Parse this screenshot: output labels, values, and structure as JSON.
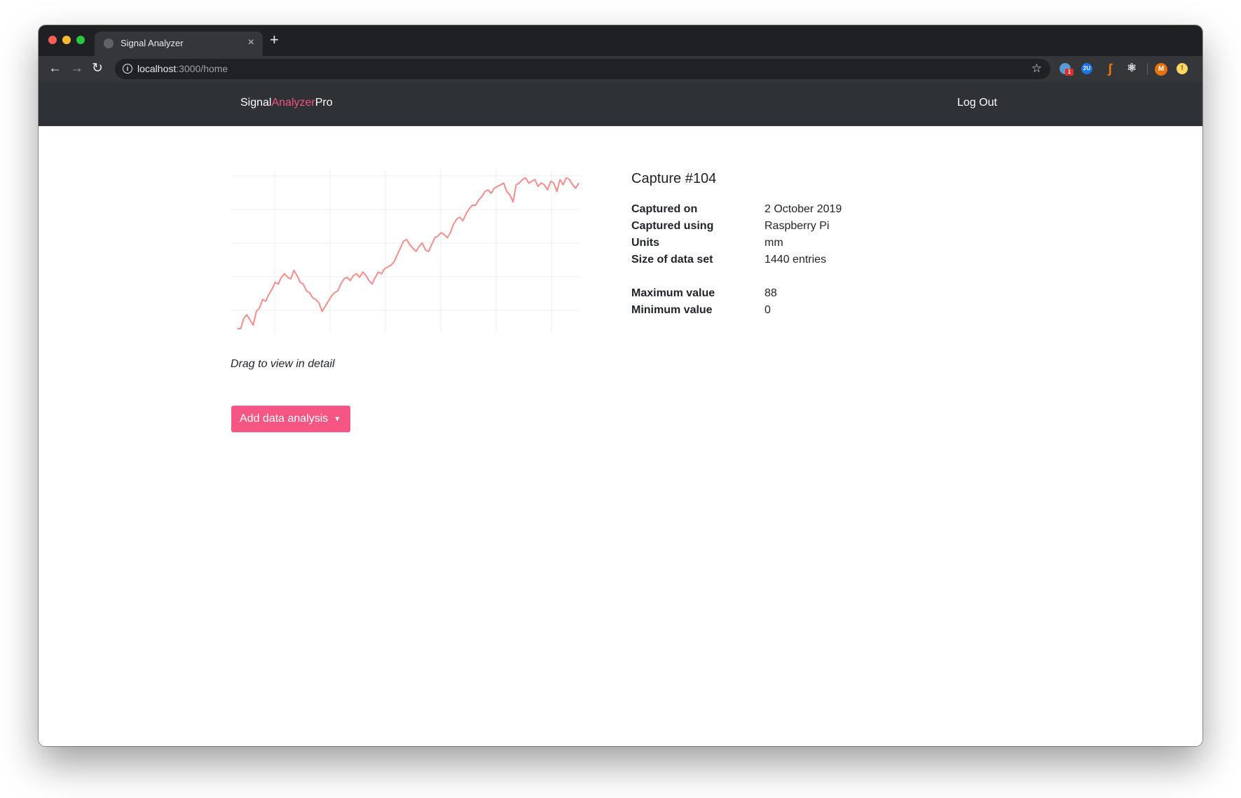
{
  "browser": {
    "tab_title": "Signal Analyzer",
    "close_glyph": "×",
    "new_tab_glyph": "+",
    "url_host": "localhost",
    "url_path": ":3000/home",
    "extension_badge": "1",
    "extension_2_label": "2U",
    "profile_initial": "M"
  },
  "navbar": {
    "brand_part1": "Signal",
    "brand_part2": "Analyzer",
    "brand_part3": "Pro",
    "logout_label": "Log Out",
    "accent_color": "#f5517f"
  },
  "capture": {
    "title": "Capture #104",
    "fields": [
      {
        "label": "Captured on",
        "value": "2 October 2019"
      },
      {
        "label": "Captured using",
        "value": "Raspberry Pi"
      },
      {
        "label": "Units",
        "value": "mm"
      },
      {
        "label": "Size of data set",
        "value": "1440 entries"
      }
    ],
    "stats": [
      {
        "label": "Maximum value",
        "value": "88"
      },
      {
        "label": "Minimum value",
        "value": "0"
      }
    ]
  },
  "chart_hint": "Drag to view in detail",
  "analysis_button": {
    "label": "Add data analysis",
    "caret": "▼"
  },
  "chart_data": {
    "type": "line",
    "title": "",
    "xlabel": "",
    "ylabel": "",
    "grid": true,
    "line_color": "#f78c8c",
    "ylim": [
      0,
      90
    ],
    "series": [
      {
        "values": [
          0,
          0,
          6,
          8,
          5,
          2,
          10,
          12,
          17,
          16,
          20,
          23,
          27,
          26,
          30,
          32,
          30,
          29,
          34,
          31,
          27,
          26,
          22,
          21,
          18,
          17,
          15,
          10,
          13,
          16,
          19,
          21,
          22,
          26,
          29,
          30,
          28,
          31,
          32,
          30,
          33,
          31,
          28,
          26,
          30,
          33,
          32,
          35,
          36,
          37,
          39,
          43,
          47,
          51,
          52,
          49,
          47,
          45,
          48,
          50,
          46,
          45,
          49,
          53,
          54,
          56,
          55,
          53,
          56,
          61,
          64,
          65,
          63,
          67,
          70,
          72,
          72,
          75,
          77,
          80,
          81,
          79,
          82,
          83,
          84,
          85,
          80,
          78,
          74,
          84,
          85,
          87,
          88,
          85,
          86,
          87,
          83,
          85,
          84,
          81,
          86,
          85,
          80,
          87,
          84,
          88,
          87,
          84,
          82,
          85
        ]
      }
    ]
  }
}
